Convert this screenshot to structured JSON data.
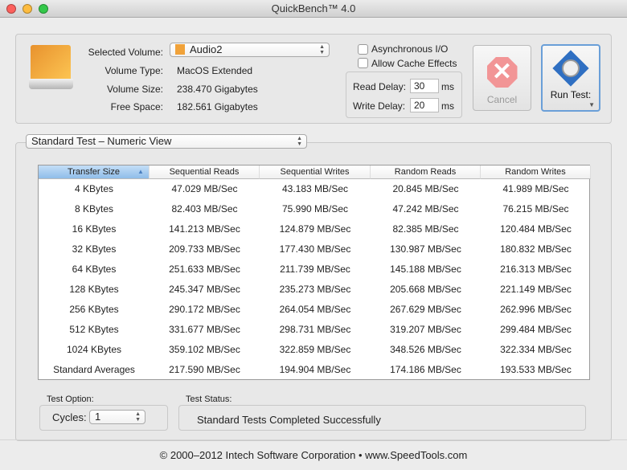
{
  "window": {
    "title": "QuickBench™ 4.0"
  },
  "volume": {
    "selected_label": "Selected Volume:",
    "selected_value": "Audio2",
    "type_label": "Volume Type:",
    "type_value": "MacOS Extended",
    "size_label": "Volume Size:",
    "size_value": "238.470 Gigabytes",
    "free_label": "Free Space:",
    "free_value": "182.561 Gigabytes"
  },
  "options": {
    "async_label": "Asynchronous I/O",
    "async_checked": false,
    "cache_label": "Allow Cache Effects",
    "cache_checked": false,
    "read_delay_label": "Read Delay:",
    "read_delay_value": "30",
    "write_delay_label": "Write Delay:",
    "write_delay_value": "20",
    "unit": "ms"
  },
  "buttons": {
    "cancel": "Cancel",
    "run": "Run Test:"
  },
  "view_select": "Standard Test – Numeric View",
  "table": {
    "columns": [
      "Transfer Size",
      "Sequential Reads",
      "Sequential Writes",
      "Random Reads",
      "Random Writes"
    ],
    "rows": [
      [
        "4 KBytes",
        "47.029 MB/Sec",
        "43.183 MB/Sec",
        "20.845 MB/Sec",
        "41.989 MB/Sec"
      ],
      [
        "8 KBytes",
        "82.403 MB/Sec",
        "75.990 MB/Sec",
        "47.242 MB/Sec",
        "76.215 MB/Sec"
      ],
      [
        "16 KBytes",
        "141.213 MB/Sec",
        "124.879 MB/Sec",
        "82.385 MB/Sec",
        "120.484 MB/Sec"
      ],
      [
        "32 KBytes",
        "209.733 MB/Sec",
        "177.430 MB/Sec",
        "130.987 MB/Sec",
        "180.832 MB/Sec"
      ],
      [
        "64 KBytes",
        "251.633 MB/Sec",
        "211.739 MB/Sec",
        "145.188 MB/Sec",
        "216.313 MB/Sec"
      ],
      [
        "128 KBytes",
        "245.347 MB/Sec",
        "235.273 MB/Sec",
        "205.668 MB/Sec",
        "221.149 MB/Sec"
      ],
      [
        "256 KBytes",
        "290.172 MB/Sec",
        "264.054 MB/Sec",
        "267.629 MB/Sec",
        "262.996 MB/Sec"
      ],
      [
        "512 KBytes",
        "331.677 MB/Sec",
        "298.731 MB/Sec",
        "319.207 MB/Sec",
        "299.484 MB/Sec"
      ],
      [
        "1024 KBytes",
        "359.102 MB/Sec",
        "322.859 MB/Sec",
        "348.526 MB/Sec",
        "322.334 MB/Sec"
      ],
      [
        "Standard Averages",
        "217.590 MB/Sec",
        "194.904 MB/Sec",
        "174.186 MB/Sec",
        "193.533 MB/Sec"
      ]
    ]
  },
  "test_option": {
    "label": "Test Option:",
    "cycles_label": "Cycles:",
    "cycles_value": "1"
  },
  "test_status": {
    "label": "Test Status:",
    "value": "Standard Tests Completed Successfully"
  },
  "footer": "© 2000–2012 Intech Software Corporation • www.SpeedTools.com"
}
